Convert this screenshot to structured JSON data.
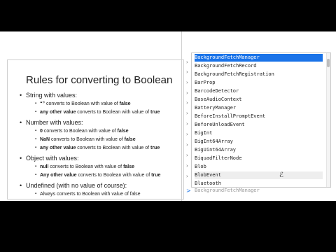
{
  "slide": {
    "title": "Rules for converting to Boolean",
    "sections": [
      {
        "heading": "String with values:",
        "items": [
          {
            "pre": "",
            "em": "“”",
            "post": " converts to Boolean with value of ",
            "val": "false"
          },
          {
            "pre": "",
            "em": "any other value",
            "post": " converts to Boolean with value of ",
            "val": "true"
          }
        ]
      },
      {
        "heading": "Number with values:",
        "items": [
          {
            "pre": "",
            "em": "0",
            "post": " converts to Boolean with value of ",
            "val": "false"
          },
          {
            "pre": "",
            "em": "NaN",
            "post": " converts to Boolean with value of ",
            "val": "false"
          },
          {
            "pre": "",
            "em": "any other value",
            "post": " converts to Boolean with value of ",
            "val": "true"
          }
        ]
      },
      {
        "heading": "Object with values:",
        "items": [
          {
            "pre": "",
            "em": "null",
            "post": " converts to Boolean with value of ",
            "val": "false"
          },
          {
            "pre": "",
            "em": "Any other value",
            "post": " converts to Boolean with value of ",
            "val": "true"
          }
        ]
      },
      {
        "heading": "Undefined (with no value of course):",
        "items": [
          {
            "pre": "Always converts to Boolean with value of false",
            "em": "",
            "post": "",
            "val": ""
          }
        ]
      }
    ]
  },
  "autocomplete": {
    "items": [
      "BackgroundFetchManager",
      "BackgroundFetchRecord",
      "BackgroundFetchRegistration",
      "BarProp",
      "BarcodeDetector",
      "BaseAudioContext",
      "BatteryManager",
      "BeforeInstallPromptEvent",
      "BeforeUnloadEvent",
      "BigInt",
      "BigInt64Array",
      "BigUint64Array",
      "BiquadFilterNode",
      "Blob",
      "BlobEvent",
      "Bluetooth"
    ],
    "selected_index": 0,
    "hover_index": 14
  },
  "console": {
    "prompt_symbol": ">",
    "input_text": "BackgroundFetchManager"
  }
}
